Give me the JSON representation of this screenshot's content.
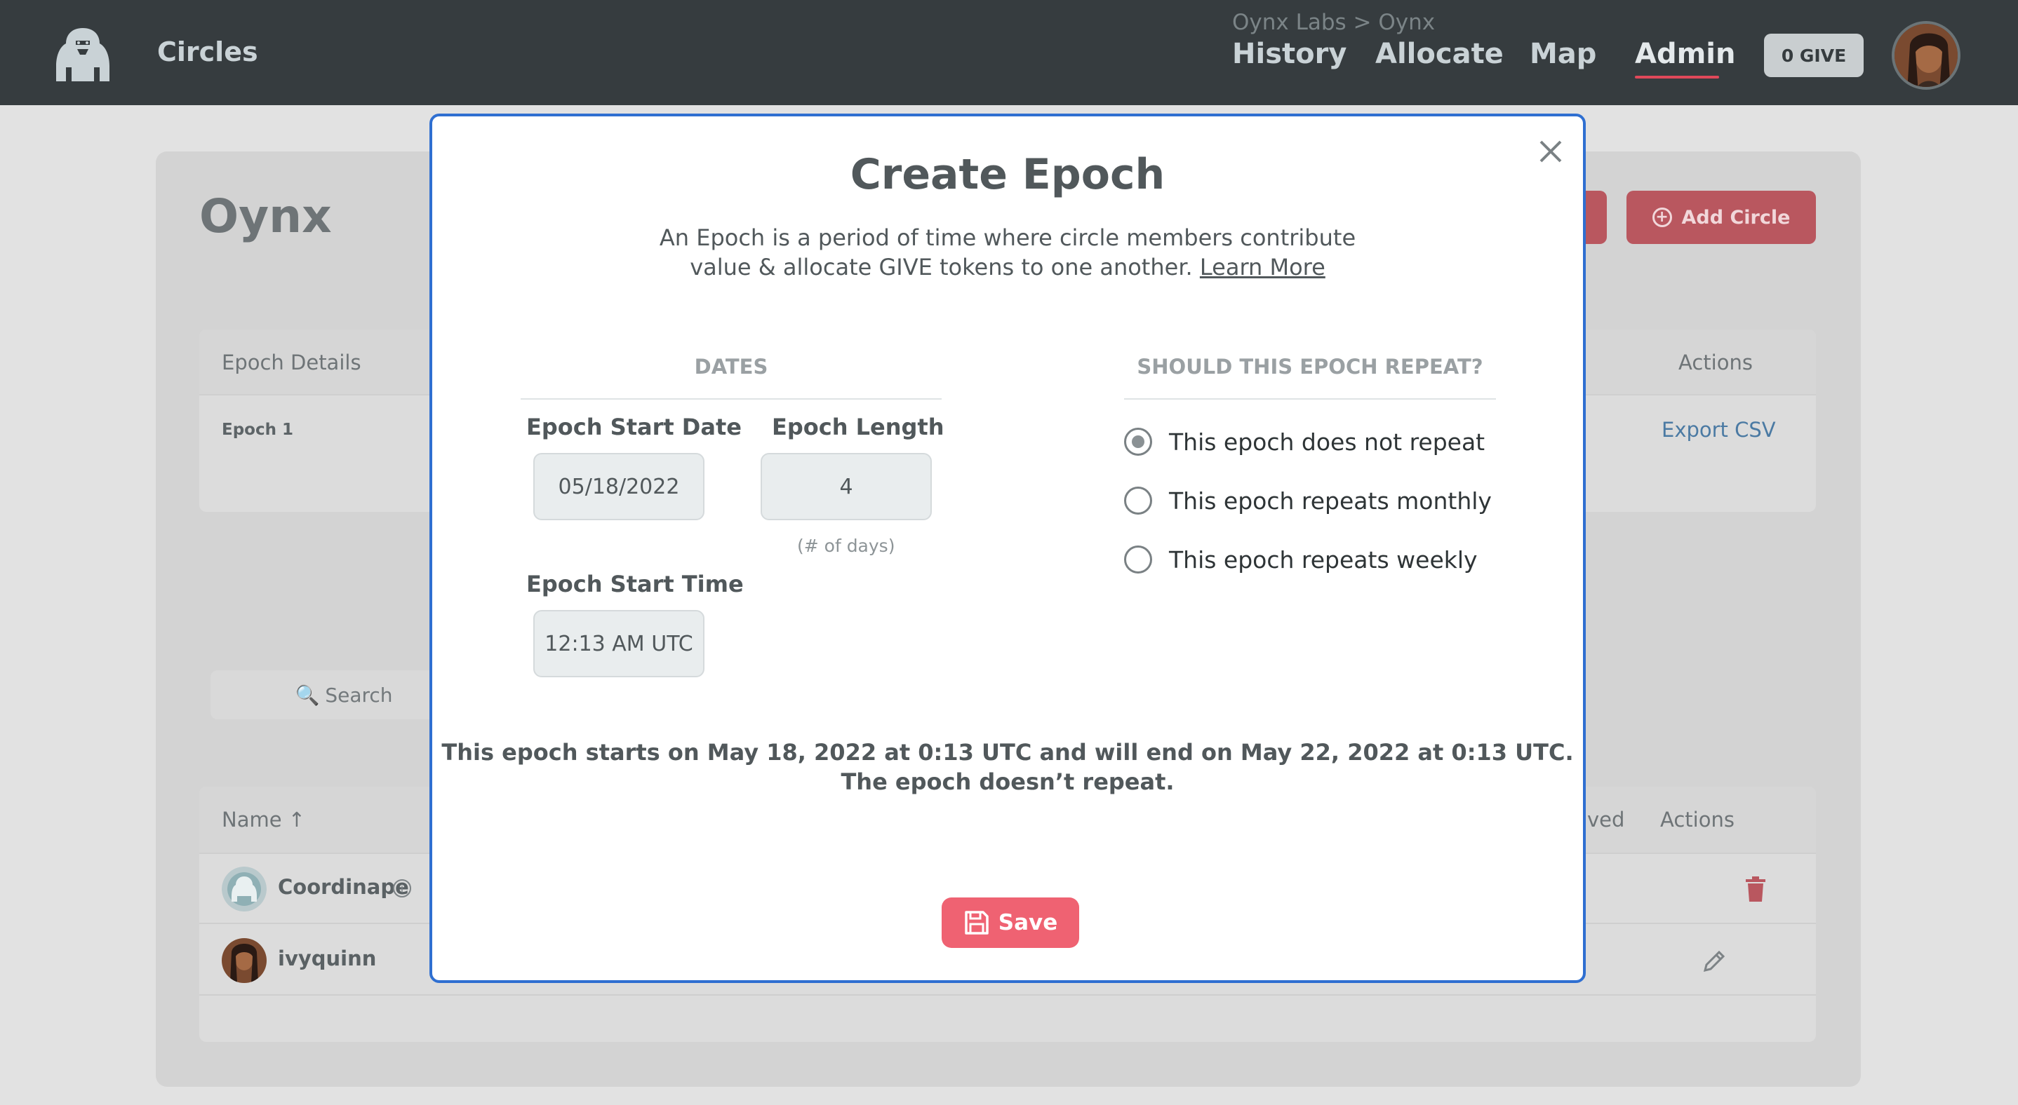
{
  "header": {
    "brand": "Circles",
    "breadcrumb": "Oynx Labs > Oynx",
    "nav": {
      "history": "History",
      "allocate": "Allocate",
      "map": "Map",
      "admin": "Admin"
    },
    "give_balance": "0 GIVE"
  },
  "page": {
    "circle_name": "Oynx",
    "add_circle_label": "Add Circle",
    "epochs_table": {
      "col_details": "Epoch Details",
      "col_actions": "Actions",
      "rows": [
        {
          "name": "Epoch 1",
          "action": "Export CSV"
        }
      ]
    },
    "search_placeholder": "Search",
    "users_table": {
      "col_name": "Name ↑",
      "col_received_partial": "ved",
      "col_actions": "Actions",
      "rows": [
        {
          "name": "Coordinape"
        },
        {
          "name": "ivyquinn"
        }
      ]
    }
  },
  "modal": {
    "title": "Create Epoch",
    "description": "An Epoch is a period of time where circle members contribute value & allocate GIVE tokens to one another.",
    "learn_more": "Learn More",
    "dates_heading": "DATES",
    "repeat_heading": "SHOULD THIS EPOCH REPEAT?",
    "start_date_label": "Epoch Start Date",
    "start_date_value": "05/18/2022",
    "length_label": "Epoch Length",
    "length_value": "4",
    "length_hint": "(# of days)",
    "start_time_label": "Epoch Start Time",
    "start_time_value": "12:13 AM UTC",
    "repeat_options": [
      {
        "label": "This epoch does not repeat",
        "selected": true
      },
      {
        "label": "This epoch repeats monthly",
        "selected": false
      },
      {
        "label": "This epoch repeats weekly",
        "selected": false
      }
    ],
    "summary_line1": "This epoch starts on May 18, 2022 at 0:13 UTC and will end on May 22, 2022 at 0:13 UTC.",
    "summary_line2": "The epoch doesn’t repeat.",
    "save_label": "Save"
  },
  "colors": {
    "topbar": "#363c3f",
    "accent_red": "#ef6272",
    "modal_border": "#2f6fd1",
    "link_blue": "#4b7aa3"
  }
}
